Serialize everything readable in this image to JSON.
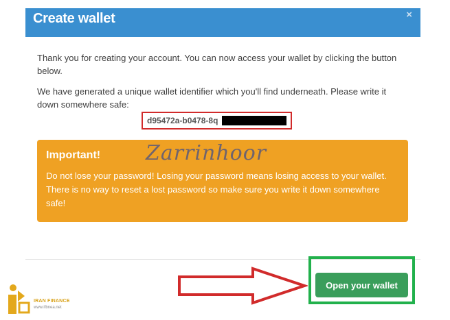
{
  "dialog": {
    "title": "Create wallet",
    "close_label": "×",
    "intro_text": "Thank you for creating your account. You can now access your wallet by clicking the button below.",
    "identifier_text": "We have generated a unique wallet identifier which you'll find underneath. Please write it down somewhere safe:",
    "wallet_id_visible": "d95472a-b0478-8q",
    "important": {
      "title": "Important!",
      "message": "Do not lose your password! Losing your password means losing access to your wallet. There is no way to reset a lost password so make sure you write it down somewhere safe!"
    },
    "open_button_label": "Open your wallet"
  },
  "overlay": {
    "watermark_text": "Zarrinhoor",
    "logo_tagline": "IRAN FINANCE",
    "logo_url": "www.ifbnea.net"
  },
  "colors": {
    "header_bg": "#3a8fd0",
    "alert_bg": "#efa123",
    "button_bg": "#3a9e5b",
    "highlight_red": "#d12b2b",
    "highlight_green": "#22b14c"
  }
}
